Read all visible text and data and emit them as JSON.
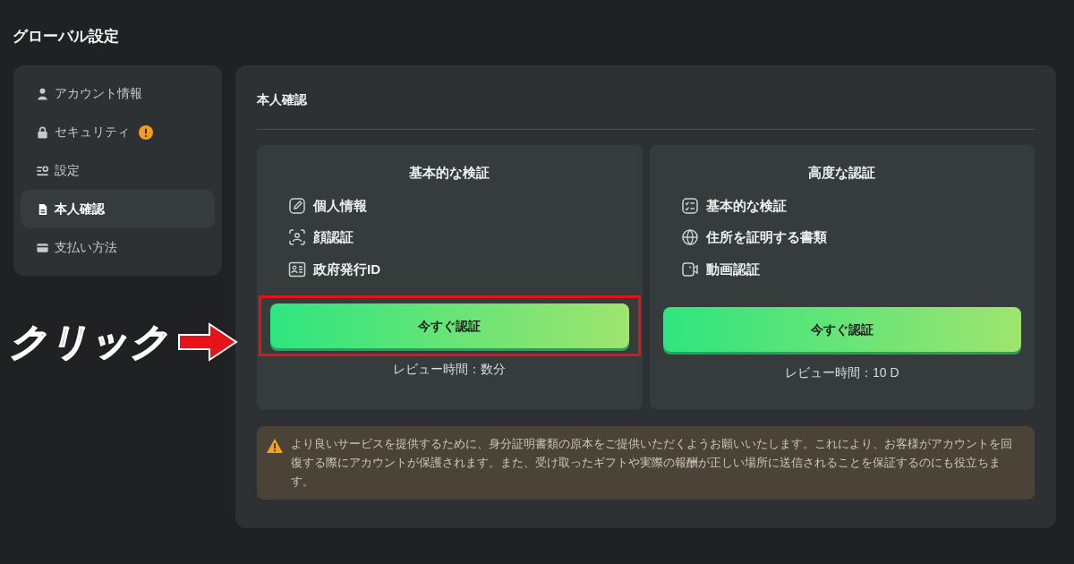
{
  "page": {
    "title": "グローバル設定"
  },
  "sidebar": {
    "items": [
      {
        "label": "アカウント情報",
        "kind": "person",
        "selected": false,
        "alert": false
      },
      {
        "label": "セキュリティ",
        "kind": "lock",
        "selected": false,
        "alert": true
      },
      {
        "label": "設定",
        "kind": "sliders",
        "selected": false,
        "alert": false
      },
      {
        "label": "本人確認",
        "kind": "document",
        "selected": true,
        "alert": false
      },
      {
        "label": "支払い方法",
        "kind": "card",
        "selected": false,
        "alert": false
      }
    ]
  },
  "section": {
    "title": "本人確認"
  },
  "cards": [
    {
      "title": "基本的な検証",
      "highlighted": true,
      "button": "今すぐ認証",
      "review": "レビュー時間：数分",
      "items": [
        {
          "label": "個人情報",
          "kind": "pencil"
        },
        {
          "label": "顔認証",
          "kind": "face"
        },
        {
          "label": "政府発行ID",
          "kind": "idcard"
        }
      ]
    },
    {
      "title": "高度な認証",
      "highlighted": false,
      "button": "今すぐ認証",
      "review": "レビュー時間：10 D",
      "items": [
        {
          "label": "基本的な検証",
          "kind": "checklist"
        },
        {
          "label": "住所を証明する書類",
          "kind": "globe"
        },
        {
          "label": "動画認証",
          "kind": "video"
        }
      ]
    }
  ],
  "notice": {
    "text": "より良いサービスを提供するために、身分証明書類の原本をご提供いただくようお願いいたします。これにより、お客様がアカウントを回復する際にアカウントが保護されます。また、受け取ったギフトや実際の報酬が正しい場所に送信されることを保証するのにも役立ちます。"
  },
  "annotation": {
    "text": "クリック"
  }
}
